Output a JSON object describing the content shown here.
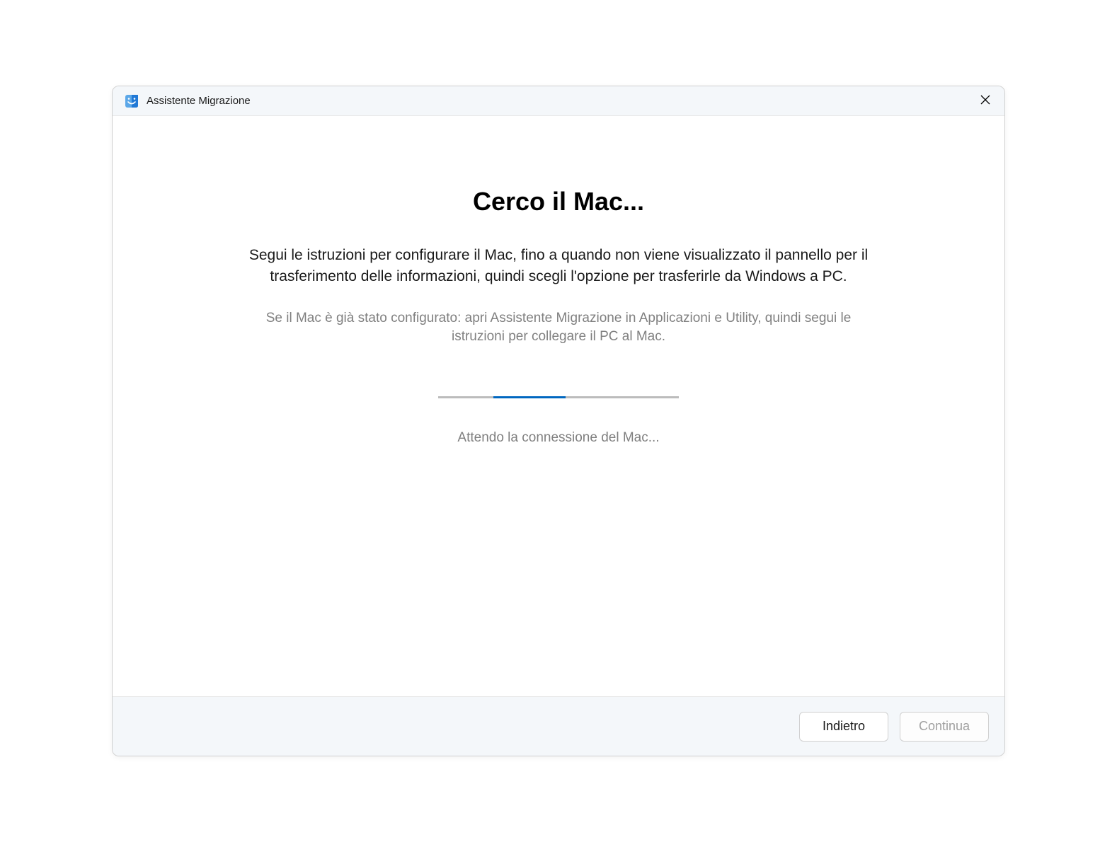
{
  "titlebar": {
    "app_title": "Assistente Migrazione"
  },
  "main": {
    "heading": "Cerco il Mac...",
    "instructions": "Segui le istruzioni per configurare il Mac, fino a quando non viene visualizzato il pannello per il trasferimento delle informazioni, quindi scegli l'opzione per trasferirle da Windows a PC.",
    "subtext": "Se il Mac è già stato configurato: apri Assistente Migrazione in Applicazioni e Utility, quindi segui le istruzioni per collegare il PC al Mac.",
    "status_text": "Attendo la connessione del Mac...",
    "progress": {
      "indeterminate": true,
      "segment_left_pct": 23,
      "segment_width_pct": 30
    }
  },
  "footer": {
    "back_label": "Indietro",
    "continue_label": "Continua",
    "continue_enabled": false
  }
}
